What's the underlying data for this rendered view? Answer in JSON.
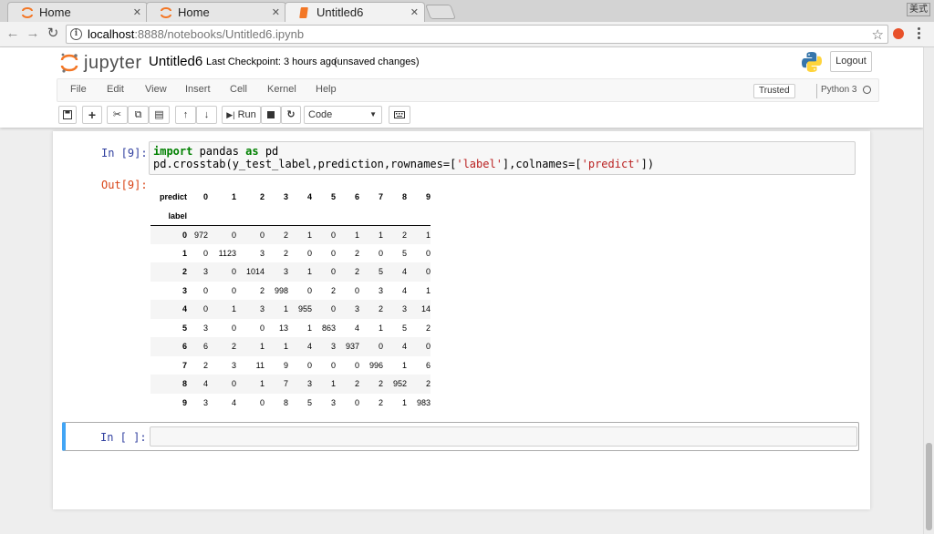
{
  "browser": {
    "tabs": [
      {
        "title": "Home",
        "active": false
      },
      {
        "title": "Home",
        "active": false
      },
      {
        "title": "Untitled6",
        "active": true
      }
    ],
    "ime_label": "美式",
    "url_host": "localhost",
    "url_path": ":8888/notebooks/Untitled6.ipynb"
  },
  "jupyter": {
    "logo_text": "jupyter",
    "notebook_title": "Untitled6",
    "checkpoint": "Last Checkpoint: 3 hours ago",
    "unsaved": "(unsaved changes)",
    "logout_label": "Logout",
    "menu": [
      "File",
      "Edit",
      "View",
      "Insert",
      "Cell",
      "Kernel",
      "Help"
    ],
    "trusted_label": "Trusted",
    "kernel_name": "Python 3",
    "toolbar": {
      "run_label": "Run",
      "cell_type": "Code"
    }
  },
  "cells": {
    "cell1": {
      "in_prompt": "In [9]:",
      "line1_kw1": "import",
      "line1_mod": " pandas ",
      "line1_kw2": "as",
      "line1_alias": " pd",
      "line2_a": "pd.crosstab(y_test_label,prediction,rownames=[",
      "line2_s1": "'label'",
      "line2_b": "],colnames=[",
      "line2_s2": "'predict'",
      "line2_c": "])",
      "out_prompt": "Out[9]:"
    },
    "cell2": {
      "in_prompt": "In [ ]:"
    }
  },
  "crosstab": {
    "col_index_name": "predict",
    "row_index_name": "label",
    "columns": [
      "0",
      "1",
      "2",
      "3",
      "4",
      "5",
      "6",
      "7",
      "8",
      "9"
    ],
    "rows": [
      {
        "label": "0",
        "values": [
          972,
          0,
          0,
          2,
          1,
          0,
          1,
          1,
          2,
          1
        ]
      },
      {
        "label": "1",
        "values": [
          0,
          1123,
          3,
          2,
          0,
          0,
          2,
          0,
          5,
          0
        ]
      },
      {
        "label": "2",
        "values": [
          3,
          0,
          1014,
          3,
          1,
          0,
          2,
          5,
          4,
          0
        ]
      },
      {
        "label": "3",
        "values": [
          0,
          0,
          2,
          998,
          0,
          2,
          0,
          3,
          4,
          1
        ]
      },
      {
        "label": "4",
        "values": [
          0,
          1,
          3,
          1,
          955,
          0,
          3,
          2,
          3,
          14
        ]
      },
      {
        "label": "5",
        "values": [
          3,
          0,
          0,
          13,
          1,
          863,
          4,
          1,
          5,
          2
        ]
      },
      {
        "label": "6",
        "values": [
          6,
          2,
          1,
          1,
          4,
          3,
          937,
          0,
          4,
          0
        ]
      },
      {
        "label": "7",
        "values": [
          2,
          3,
          11,
          9,
          0,
          0,
          0,
          996,
          1,
          6
        ]
      },
      {
        "label": "8",
        "values": [
          4,
          0,
          1,
          7,
          3,
          1,
          2,
          2,
          952,
          2
        ]
      },
      {
        "label": "9",
        "values": [
          3,
          4,
          0,
          8,
          5,
          3,
          0,
          2,
          1,
          983
        ]
      }
    ]
  },
  "colors": {
    "in_prompt": "#303f9f",
    "out_prompt": "#d84315",
    "selected_cell_bar": "#42a5f5",
    "keyword": "#008000",
    "string": "#ba2121"
  }
}
